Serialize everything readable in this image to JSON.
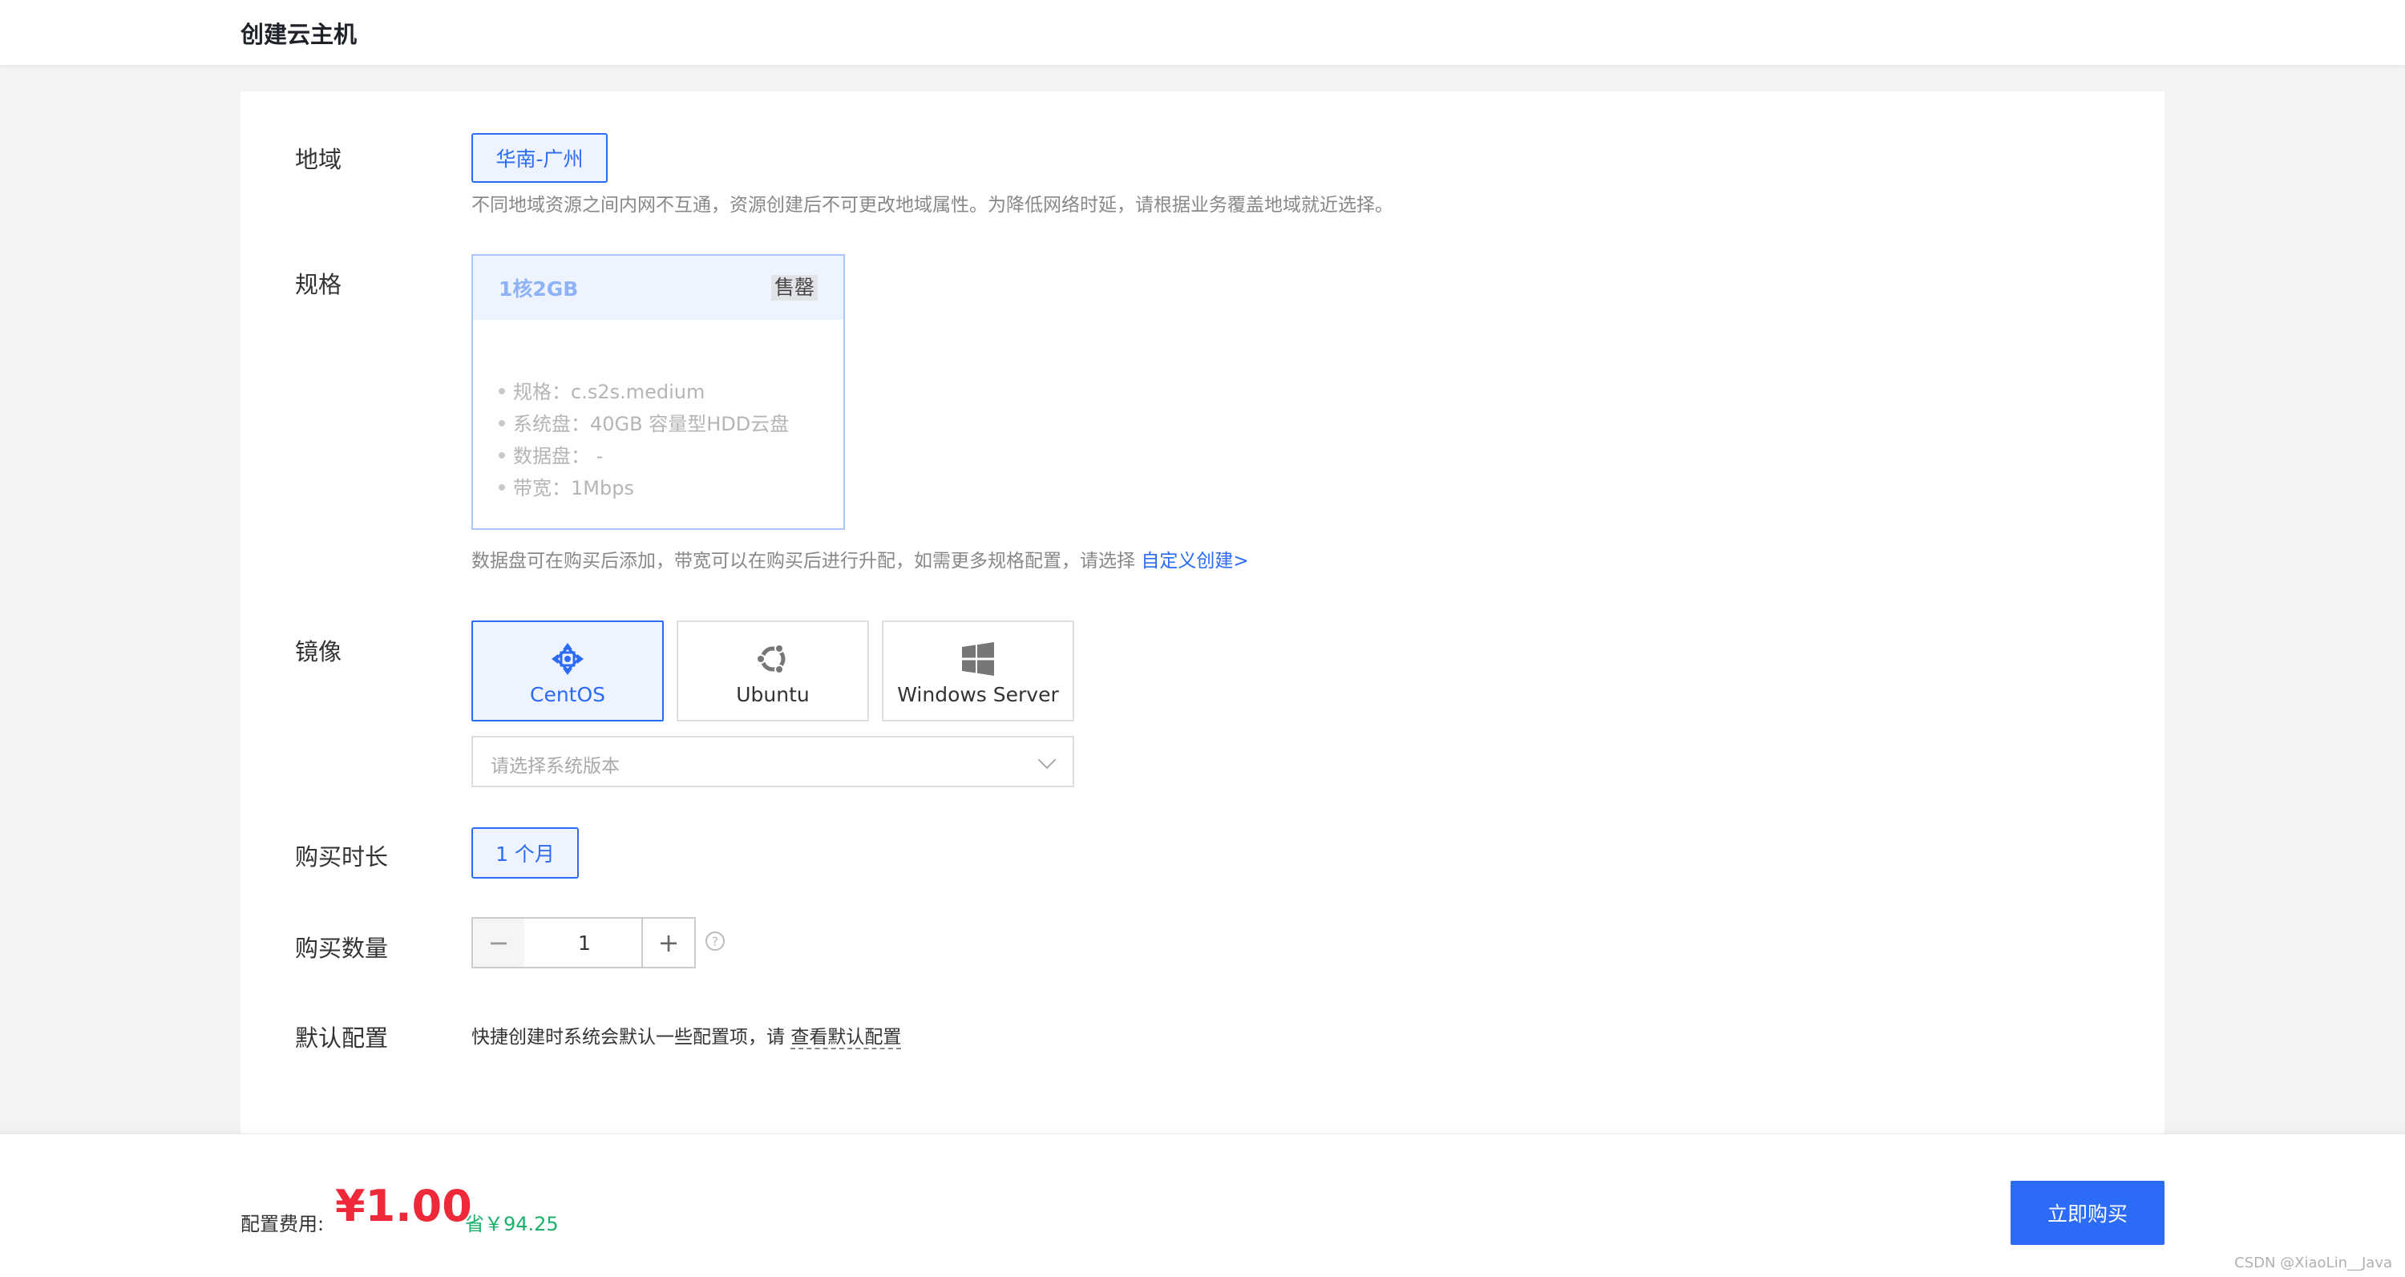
{
  "header": {
    "title": "创建云主机"
  },
  "region": {
    "label": "地域",
    "selected": "华南-广州",
    "description": "不同地域资源之间内网不互通，资源创建后不可更改地域属性。为降低网络时延，请根据业务覆盖地域就近选择。"
  },
  "spec": {
    "label": "规格",
    "card": {
      "name": "1核2GB",
      "badge": "售罄",
      "items": [
        "规格：c.s2s.medium",
        "系统盘：40GB 容量型HDD云盘",
        "数据盘： -",
        "带宽：1Mbps"
      ]
    },
    "note": "数据盘可在购买后添加，带宽可以在购买后进行升配，如需更多规格配置，请选择 ",
    "link": "自定义创建>"
  },
  "image": {
    "label": "镜像",
    "options": [
      {
        "name": "CentOS",
        "icon": "centos-icon",
        "selected": true
      },
      {
        "name": "Ubuntu",
        "icon": "ubuntu-icon",
        "selected": false
      },
      {
        "name": "Windows Server",
        "icon": "windows-icon",
        "selected": false
      }
    ],
    "version_placeholder": "请选择系统版本"
  },
  "duration": {
    "label": "购买时长",
    "selected": "1 个月"
  },
  "quantity": {
    "label": "购买数量",
    "value": "1",
    "minus": "−",
    "plus": "+",
    "help": "?"
  },
  "defaults": {
    "label": "默认配置",
    "text": "快捷创建时系统会默认一些配置项，请 ",
    "link": "查看默认配置"
  },
  "footer": {
    "fee_label": "配置费用:",
    "fee_value": "¥1.00",
    "save": "省￥94.25",
    "buy": "立即购买"
  },
  "watermark": "CSDN @XiaoLin__Java",
  "colors": {
    "accent": "#2b6bf5",
    "price": "#ee2a3a",
    "save": "#1ab26b"
  }
}
